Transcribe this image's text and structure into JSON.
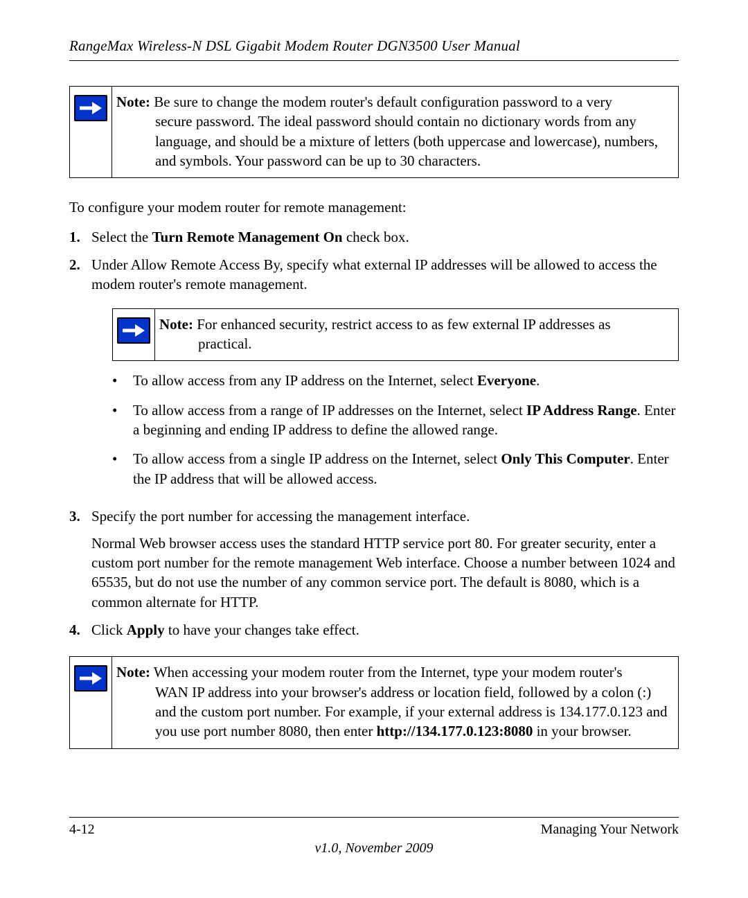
{
  "header": {
    "title": "RangeMax Wireless-N DSL Gigabit Modem Router DGN3500 User Manual"
  },
  "note1": {
    "label": "Note:",
    "text_line1": " Be sure to change the modem router's default configuration password to a very",
    "text_rest": "secure password. The ideal password should contain no dictionary words from any language, and should be a mixture of letters (both uppercase and lowercase), numbers, and symbols. Your password can be up to 30 characters."
  },
  "intro": "To configure your modem router for remote management:",
  "steps": {
    "s1": {
      "num": "1.",
      "pre": "Select the ",
      "bold": "Turn Remote Management On",
      "post": " check box."
    },
    "s2": {
      "num": "2.",
      "text": "Under Allow Remote Access By, specify what external IP addresses will be allowed to access the modem router's remote management."
    },
    "s3": {
      "num": "3.",
      "text": "Specify the port number for accessing the management interface.",
      "para": "Normal Web browser access uses the standard HTTP service port 80. For greater security, enter a custom port number for the remote management Web interface. Choose a number between 1024 and 65535, but do not use the number of any common service port. The default is 8080, which is a common alternate for HTTP."
    },
    "s4": {
      "num": "4.",
      "pre": "Click ",
      "bold": "Apply",
      "post": " to have your changes take effect."
    }
  },
  "note2": {
    "label": "Note:",
    "text_line1": " For enhanced security, restrict access to as few external IP addresses as",
    "text_rest": "practical."
  },
  "bullets": {
    "b1": {
      "pre": "To allow access from any IP address on the Internet, select ",
      "bold": "Everyone",
      "post": "."
    },
    "b2": {
      "pre": "To allow access from a range of IP addresses on the Internet, select ",
      "bold": "IP Address Range",
      "post": ". Enter a beginning and ending IP address to define the allowed range."
    },
    "b3": {
      "pre": "To allow access from a single IP address on the Internet, select ",
      "bold": "Only This Computer",
      "post": ". Enter the IP address that will be allowed access."
    }
  },
  "note3": {
    "label": "Note:",
    "text_line1": " When accessing your modem router from the Internet, type your modem router's",
    "text_rest_pre": "WAN IP address into your browser's address or location field, followed by a colon (:) and the custom port number. For example, if your external address is 134.177.0.123 and you use port number 8080, then enter ",
    "bold1": "http://134.177.0.123:8080",
    "text_rest_post": " in your browser."
  },
  "footer": {
    "page": "4-12",
    "section": "Managing Your Network",
    "version": "v1.0, November 2009"
  }
}
